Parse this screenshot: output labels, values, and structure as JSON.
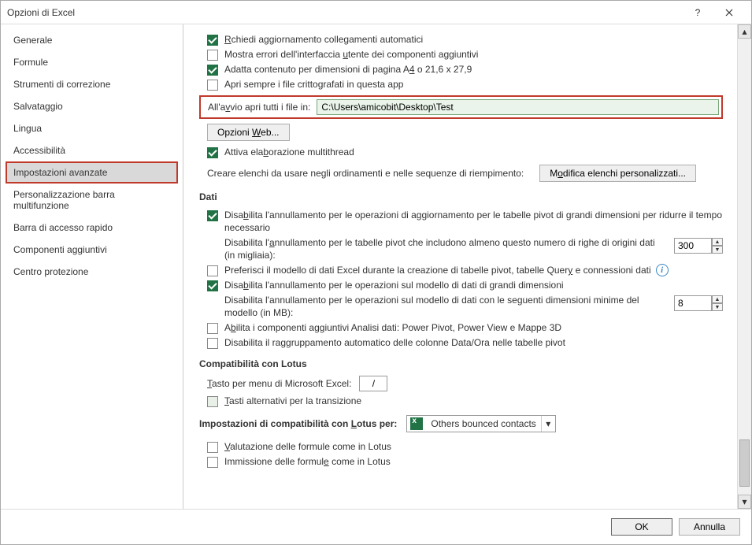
{
  "title": "Opzioni di Excel",
  "nav": {
    "items": [
      "Generale",
      "Formule",
      "Strumenti di correzione",
      "Salvataggio",
      "Lingua",
      "Accessibilità",
      "Impostazioni avanzate",
      "Personalizzazione barra multifunzione",
      "Barra di accesso rapido",
      "Componenti aggiuntivi",
      "Centro protezione"
    ],
    "selected": 6
  },
  "opts": {
    "richiedi_prefix": "R",
    "richiedi_rest": "chiedi aggiornamento collegamenti automatici",
    "mostra_prefix": "Mostra errori dell'interfaccia ",
    "mostra_und": "u",
    "mostra_rest": "tente dei componenti aggiuntivi",
    "adatta_prefix": "Adatta contenuto per dimensioni di pagina A",
    "adatta_und": "4",
    "adatta_rest": " o 21,6 x 27,9",
    "apri_sempre": "Apri sempre i file crittografati in questa app",
    "avvio_prefix": "All'a",
    "avvio_und": "v",
    "avvio_rest": "vio apri tutti i file in:",
    "avvio_value": "C:\\Users\\amicobit\\Desktop\\Test",
    "opzioni_web_prefix": "Opzioni ",
    "opzioni_web_und": "W",
    "opzioni_web_rest": "eb...",
    "attiva_prefix": "Attiva ela",
    "attiva_und": "b",
    "attiva_rest": "orazione multithread",
    "creare": "Creare elenchi da usare negli ordinamenti e nelle sequenze di riempimento:",
    "modifica_prefix": "M",
    "modifica_und": "o",
    "modifica_rest": "difica elenchi personalizzati..."
  },
  "dati": {
    "heading": "Dati",
    "pivot_grandi_prefix": "Disa",
    "pivot_grandi_und": "b",
    "pivot_grandi_rest": "ilita l'annullamento per le operazioni di aggiornamento per le tabelle pivot di grandi dimensioni per ridurre il tempo necessario",
    "pivot_numero_prefix": "Disabilita l'",
    "pivot_numero_und": "a",
    "pivot_numero_rest": "nnullamento per le tabelle pivot che includono almeno questo numero di righe di origini dati (in migliaia):",
    "pivot_spinner": "300",
    "preferisci_prefix": "Preferisci il modello di dati Excel durante la creazione di tabelle pivot, tabelle Quer",
    "preferisci_und": "y",
    "preferisci_rest": " e connessioni dati",
    "disab_modello_prefix": "Disa",
    "disab_modello_und": "b",
    "disab_modello_rest": "ilita l'annullamento per le operazioni sul modello di dati di grandi dimensioni",
    "dim_minime": "Disabilita l'annullamento per le operazioni sul modello di dati con le seguenti dimensioni minime del modello (in MB):",
    "dim_spinner": "8",
    "abilita_prefix": "A",
    "abilita_und": "b",
    "abilita_rest": "ilita i componenti aggiuntivi Analisi dati: Power Pivot, Power View e Mappe 3D",
    "raggruppamento": "Disabilita il raggruppamento automatico delle colonne Data/Ora nelle tabelle pivot"
  },
  "lotus": {
    "heading": "Compatibilità con Lotus",
    "tasto_prefix": "",
    "tasto_und": "T",
    "tasto_rest": "asto per menu di Microsoft Excel:",
    "tasto_value": "/",
    "alt_prefix": "",
    "alt_und": "T",
    "alt_rest": "asti alternativi per la transizione",
    "compat_per_prefix": "Impostazioni di compatibilità con ",
    "compat_per_und": "L",
    "compat_per_rest": "otus per:",
    "compat_value": "Others bounced contacts",
    "valutazione_prefix": "",
    "valutazione_und": "V",
    "valutazione_rest": "alutazione delle formule come in Lotus",
    "immissione_prefix": "Immissione delle formul",
    "immissione_und": "e",
    "immissione_rest": " come in Lotus"
  },
  "footer": {
    "ok": "OK",
    "cancel": "Annulla"
  }
}
